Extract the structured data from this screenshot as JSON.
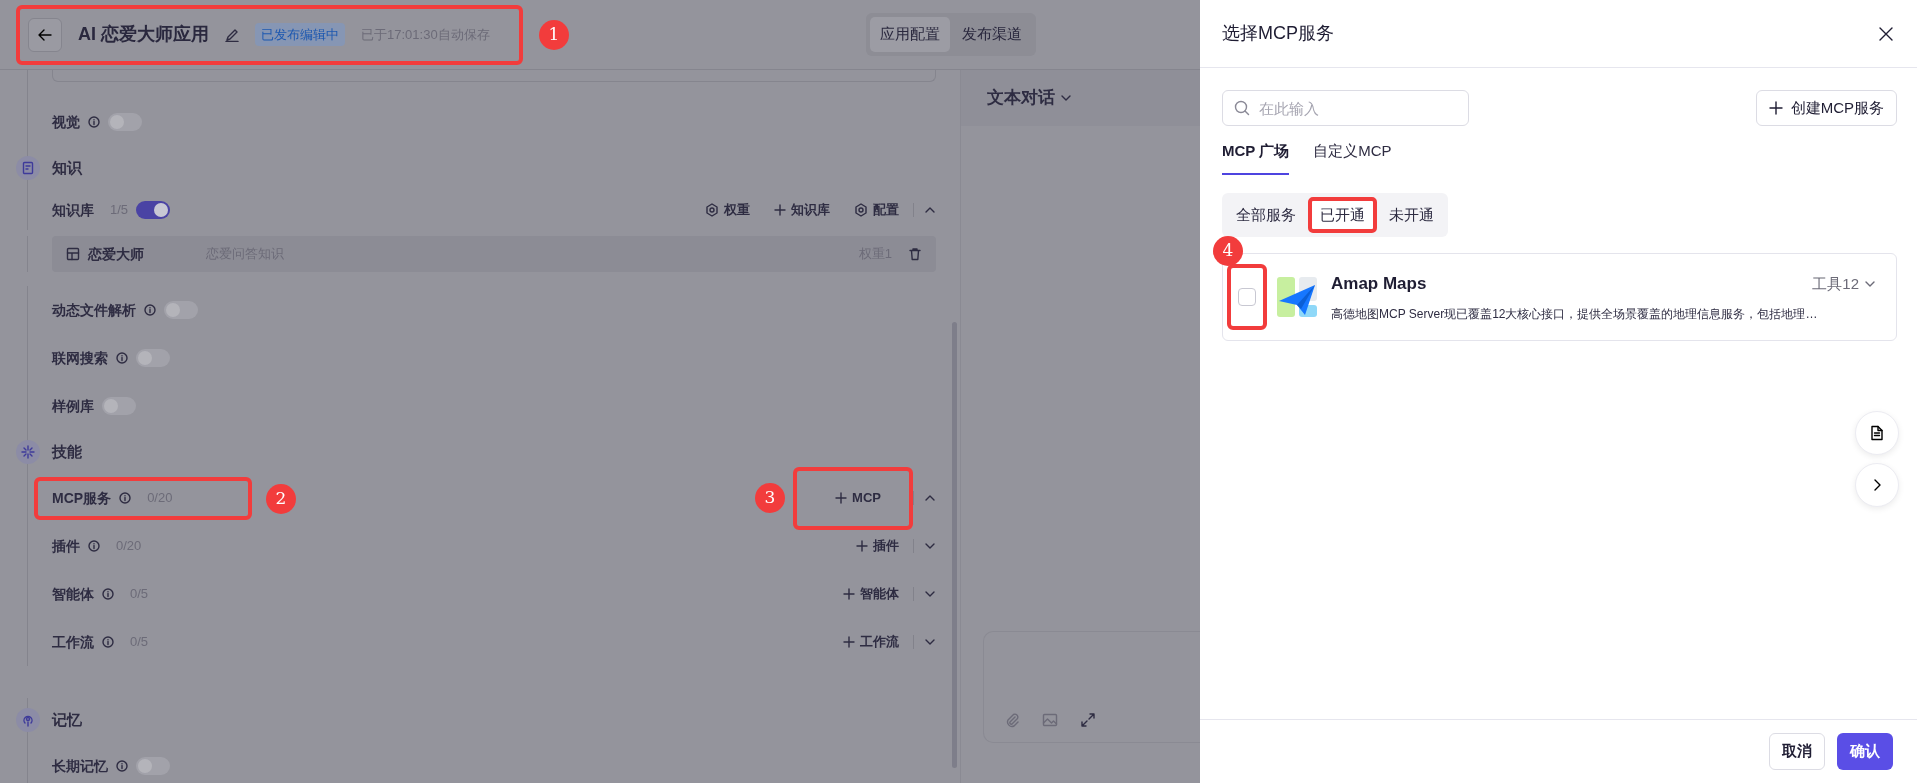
{
  "header": {
    "title": "AI 恋爱大师应用",
    "status_badge": "已发布编辑中",
    "autosave": "已于17:01:30自动保存",
    "annotation": "1",
    "tabs": [
      {
        "label": "应用配置",
        "selected": true
      },
      {
        "label": "发布渠道",
        "selected": false
      }
    ]
  },
  "config": {
    "items": [
      {
        "kind": "toggle",
        "label": "视觉",
        "info": true,
        "on": false
      },
      {
        "kind": "section",
        "title": "知识"
      },
      {
        "kind": "resource",
        "label": "知识库",
        "info": false,
        "count": "1/5",
        "on": true,
        "expanded": true,
        "actions": [
          {
            "kind": "weight",
            "label": "权重"
          },
          {
            "kind": "add",
            "label": "知识库"
          },
          {
            "kind": "settings",
            "label": "配置"
          }
        ]
      },
      {
        "kind": "entry",
        "name": "恋爱大师",
        "description": "恋爱问答知识",
        "weight": "权重1"
      },
      {
        "kind": "toggle",
        "label": "动态文件解析",
        "info": true,
        "on": false
      },
      {
        "kind": "toggle",
        "label": "联网搜索",
        "info": true,
        "on": false
      },
      {
        "kind": "toggle",
        "label": "样例库",
        "info": false,
        "on": false
      },
      {
        "kind": "section",
        "title": "技能"
      },
      {
        "kind": "resource",
        "label": "MCP服务",
        "info": true,
        "count": "0/20",
        "expanded": true,
        "annotation": "2",
        "actions": [
          {
            "kind": "add",
            "label": "MCP",
            "annotation": "3"
          }
        ]
      },
      {
        "kind": "resource",
        "label": "插件",
        "info": true,
        "count": "0/20",
        "expanded": false,
        "actions": [
          {
            "kind": "add",
            "label": "插件"
          }
        ]
      },
      {
        "kind": "resource",
        "label": "智能体",
        "info": true,
        "count": "0/5",
        "expanded": false,
        "actions": [
          {
            "kind": "add",
            "label": "智能体"
          }
        ]
      },
      {
        "kind": "resource",
        "label": "工作流",
        "info": true,
        "count": "0/5",
        "expanded": false,
        "actions": [
          {
            "kind": "add",
            "label": "工作流"
          }
        ]
      },
      {
        "kind": "section",
        "title": "记忆"
      },
      {
        "kind": "toggle",
        "label": "长期记忆",
        "info": true,
        "on": false
      }
    ]
  },
  "chat": {
    "mode": "文本对话"
  },
  "drawer": {
    "title": "选择MCP服务",
    "search": {
      "placeholder": "在此输入"
    },
    "create_button": "创建MCP服务",
    "tabs": [
      {
        "label": "MCP 广场",
        "selected": true
      },
      {
        "label": "自定义MCP",
        "selected": false
      }
    ],
    "filters": [
      {
        "label": "全部服务",
        "selected": false,
        "highlighted": false
      },
      {
        "label": "已开通",
        "selected": true,
        "highlighted": true
      },
      {
        "label": "未开通",
        "selected": false,
        "highlighted": false
      }
    ],
    "services": [
      {
        "name": "Amap Maps",
        "description": "高德地图MCP Server现已覆盖12大核心接口，提供全场景覆盖的地理信息服务，包括地理…",
        "tools": "工具12",
        "checked": false,
        "annotation": "4"
      }
    ],
    "buttons": [
      {
        "kind": "secondary",
        "label": "取消"
      },
      {
        "kind": "primary",
        "label": "确认"
      }
    ]
  }
}
